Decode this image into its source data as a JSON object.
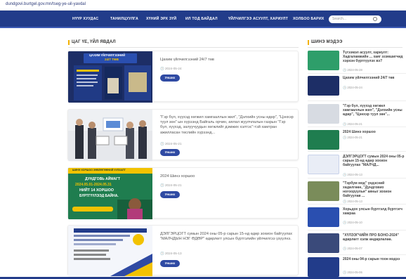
{
  "url": "dundgovi.burtgel.gov.mn/tseg-ye-uil-yavdal",
  "nav": [
    "НҮҮР ХУУДАС",
    "ТАНИЛЦУУЛГА",
    "ХҮНИЙ ЭРХ ЗҮЙ",
    "ИЛ ТОД БАЙДАЛ",
    "ҮЙЛЧИЛГЭЭ АСУУЛТ, ХАРИУЛТ",
    "ХОЛБОО БАРИХ"
  ],
  "search_placeholder": "Search...",
  "main_heading": "ЦАГ ҮЕ, ҮЙЛ ЯВДАЛ",
  "side_heading": "ШИНЭ МЭДЭЭ",
  "more_label": "Унших",
  "colors": {
    "nav": "#223c8a",
    "accent": "#f2b100",
    "button": "#2f4aa3"
  },
  "cards": [
    {
      "title": "Цахим үйлчилгээний 24/7 төв",
      "date": "2024-05-24",
      "thumb_text": [
        "ЦАХИМ ҮЙЛЧИЛГЭЭНИЙ",
        "24/7 ТӨВ"
      ]
    },
    {
      "title": "\"Гэр бүл, хүүхэд хөгжил хамгааллын жил\", \"Дэлхийн усны өдөр\", \"Цэнхэр туул зөн\" ын хүрээнд Байгаль орчин, аялал жуулчлалын газрын \"Гэр бүл, хүүхэд, залуучуудын хөгжлийг дэмжих хэлтэс\"-тэй хамтран ажилласан төслийн хүрээнд...",
      "date": "2024-05-21"
    },
    {
      "title": "2024 Шинэ хоршоо",
      "date": "2024-05-21",
      "thumb_text": [
        "ШИНЭ ХОРШОО ЗӨВЛӨГӨӨНИЙ УУЛЗАЛТ",
        "ДУНДГОВЬ АЙМАГТ",
        "2024.05.01-2024.05.31",
        "НИЙТ 14 ХОРШОО",
        "БҮРТГҮҮЛЭЭД БАЙНА."
      ]
    },
    {
      "title": "ДЭЛГЭРЦОГТ сумын 2024 оны 05-р сарын 15-нд өдөр зохион байгуулах \"МАЛЧДЫН НЭГ ӨДӨР\" өдөрлөгт улсын бүртгэлийн үйлчилгээ үзүүлнэ.",
      "date": "2024-05-13"
    }
  ],
  "side": [
    {
      "title": "Түгээмэл асуулт, хариулт: Хадгаламжийн ... хаяг эзэмшигчид хэрхэн бүртгүүлэх вэ?",
      "date": "2024-05-28"
    },
    {
      "title": "Цахим үйлчилгээний 24/7 төв",
      "date": "2024-05-24"
    },
    {
      "title": "\"Гэр бүл, хүүхэд хөгжил хамгааллын жил\", \"Дэлхийн усны өдөр\", \"Цэнхэр туул зөн\"...",
      "date": "2024-05-21"
    },
    {
      "title": "2024 Шинэ хоршоо",
      "date": "2024-05-21"
    },
    {
      "title": "ДЭЛГЭРЦОГТ сумын 2024 оны 05-р сарын 15-нд өдөр зохион байгуулах \"МАЛЧД...",
      "date": "2024-05-13"
    },
    {
      "title": "\"Тэрбум мод\" үндэсний хөдөлгөөн, \"Дундговио ногооруулья\" аяныг зохион байгуулав ...",
      "date": "2024-05-13"
    },
    {
      "title": "Хорьдох улсын бүртгэлд бүртгэгч хамраа",
      "date": "2024-05-10"
    },
    {
      "title": "\"ХҮЛЭЭГЧИЙН ПРО БОНО-2024\" өдөрлөгт хэлж өндөрлөлөө.",
      "date": "2024-05-07"
    },
    {
      "title": "2024 оны 04-р сарын тоон мэдээ",
      "date": "2024-05-06"
    }
  ]
}
